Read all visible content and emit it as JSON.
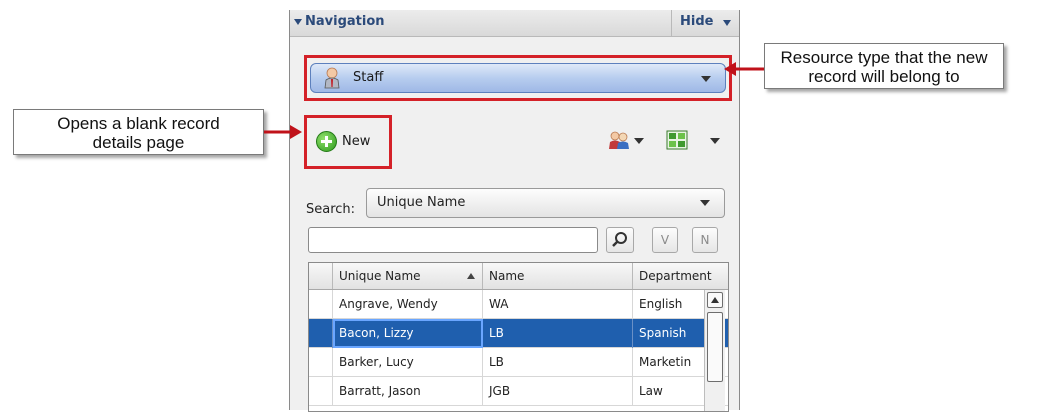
{
  "navigation": {
    "title": "Navigation",
    "hide_label": "Hide",
    "resource_type": "Staff",
    "new_label": "New",
    "search": {
      "label": "Search:",
      "field": "Unique Name",
      "input_value": "",
      "buttons": {
        "v_label": "V",
        "n_label": "N"
      }
    }
  },
  "grid": {
    "columns": [
      "Unique Name",
      "Name",
      "Department"
    ],
    "rows": [
      {
        "unique_name": "Angrave, Wendy",
        "name": "WA",
        "department": "English"
      },
      {
        "unique_name": "Bacon, Lizzy",
        "name": "LB",
        "department": "Spanish"
      },
      {
        "unique_name": "Barker, Lucy",
        "name": "LB",
        "department": "Marketin"
      },
      {
        "unique_name": "Barratt, Jason",
        "name": "JGB",
        "department": "Law"
      }
    ],
    "selected_row": 1,
    "sort_column": "Unique Name",
    "sort_direction": "ascending"
  },
  "callouts": {
    "resource": [
      "Resource type that the new",
      "record will belong to"
    ],
    "new": [
      "Opens a blank record",
      "details page"
    ]
  },
  "colors": {
    "highlight": "#d42128",
    "selection": "#1f5fae",
    "header_text": "#2b4a7a"
  },
  "icons": [
    "triangle-down-icon",
    "staff-person-icon",
    "add-circle-icon",
    "people-icon",
    "grid-view-icon",
    "magnifier-icon",
    "sort-ascending-icon",
    "scroll-up-icon"
  ]
}
